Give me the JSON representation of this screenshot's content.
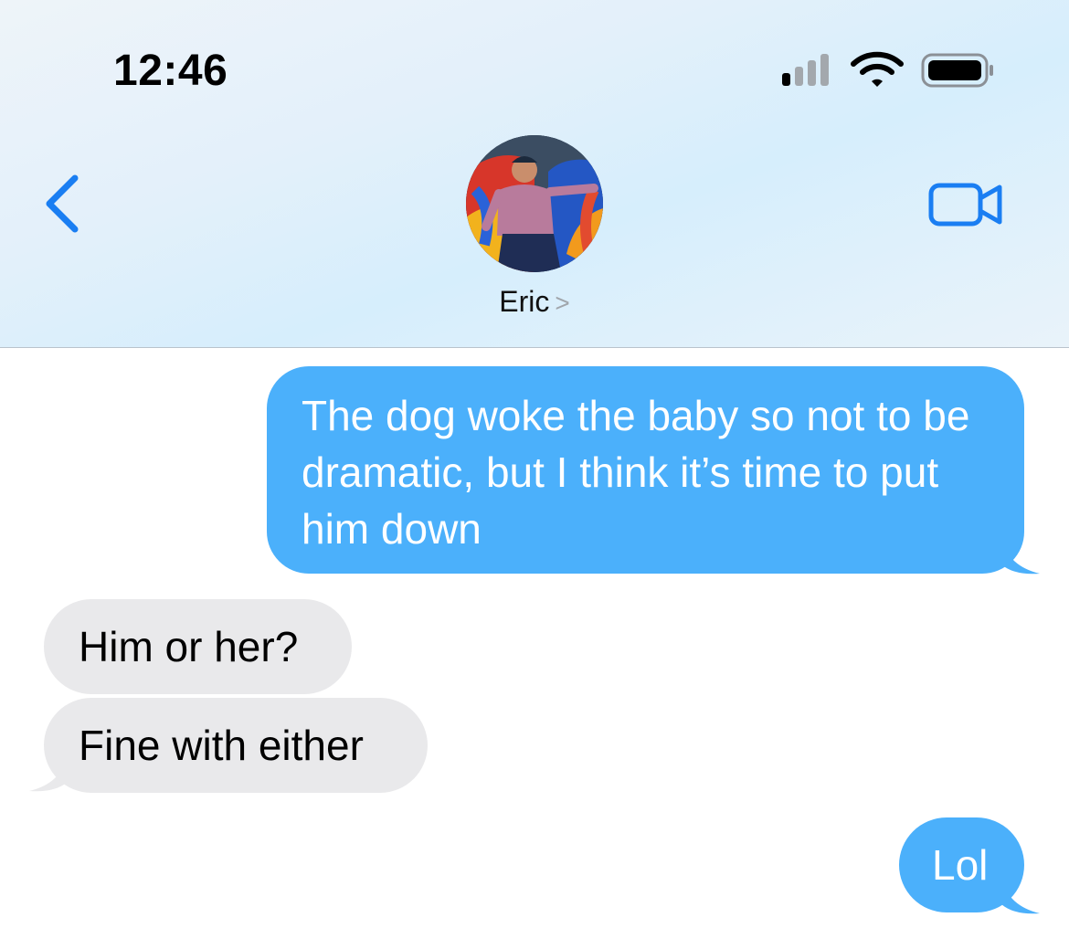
{
  "status_bar": {
    "time": "12:46",
    "icons": [
      "cellular-signal-icon",
      "wifi-icon",
      "battery-icon"
    ]
  },
  "nav": {
    "back_icon": "chevron-left-icon",
    "contact_name": "Eric",
    "contact_chevron": ">",
    "video_icon": "video-camera-icon"
  },
  "messages": [
    {
      "from": "me",
      "text": "The dog woke the baby so not to be dramatic, but I think it’s time to put him down"
    },
    {
      "from": "them",
      "text": "Him or her?"
    },
    {
      "from": "them",
      "text": "Fine with either"
    },
    {
      "from": "me",
      "text": "Lol"
    }
  ],
  "colors": {
    "sent_bubble": "#4bb0fb",
    "received_bubble": "#e9e9eb",
    "accent": "#1a7ef2"
  }
}
